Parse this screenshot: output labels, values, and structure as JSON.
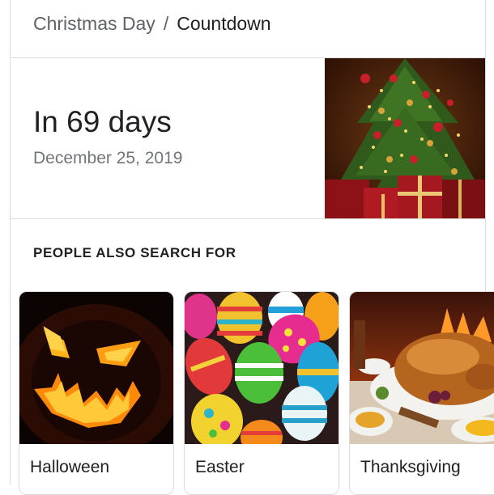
{
  "breadcrumb": {
    "parent": "Christmas Day",
    "separator": "/",
    "current": "Countdown"
  },
  "countdown": {
    "main_text": "In 69 days",
    "date_text": "December 25, 2019",
    "image_icon": "christmas-tree"
  },
  "people_also_search": {
    "heading": "PEOPLE ALSO SEARCH FOR",
    "cards": [
      {
        "label": "Halloween",
        "image_icon": "jack-o-lantern"
      },
      {
        "label": "Easter",
        "image_icon": "easter-eggs"
      },
      {
        "label": "Thanksgiving",
        "image_icon": "roast-turkey"
      }
    ]
  },
  "colors": {
    "primary_text": "#202124",
    "secondary_text": "#5f6368",
    "divider": "#dadce0"
  }
}
